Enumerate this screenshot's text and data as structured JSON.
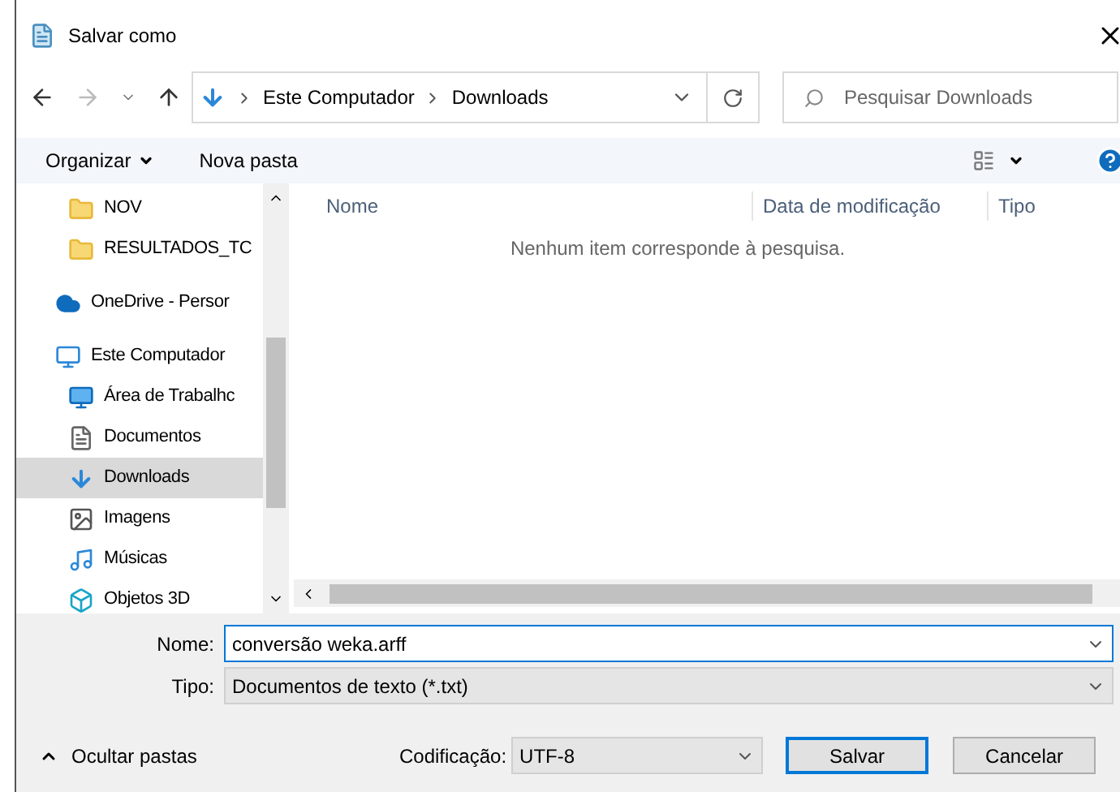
{
  "window": {
    "title": "Salvar como"
  },
  "address": {
    "path": [
      "Este Computador",
      "Downloads"
    ],
    "search_placeholder": "Pesquisar Downloads"
  },
  "toolbar": {
    "organize": "Organizar",
    "new_folder": "Nova pasta"
  },
  "sidebar": {
    "items": [
      {
        "label": "NOV",
        "kind": "folder",
        "selected": false
      },
      {
        "label": "RESULTADOS_TC",
        "kind": "folder",
        "selected": false
      },
      {
        "label": "OneDrive - Persor",
        "kind": "cloud",
        "selected": false
      },
      {
        "label": "Este Computador",
        "kind": "computer",
        "selected": false,
        "children": [
          {
            "label": "Área de Trabalhc",
            "kind": "desktop",
            "selected": false
          },
          {
            "label": "Documentos",
            "kind": "document",
            "selected": false
          },
          {
            "label": "Downloads",
            "kind": "download",
            "selected": true
          },
          {
            "label": "Imagens",
            "kind": "image",
            "selected": false
          },
          {
            "label": "Músicas",
            "kind": "music",
            "selected": false
          },
          {
            "label": "Objetos 3D",
            "kind": "cube",
            "selected": false
          }
        ]
      }
    ]
  },
  "table": {
    "columns": [
      "Nome",
      "Data de modificação",
      "Tipo"
    ],
    "empty_message": "Nenhum item corresponde à pesquisa."
  },
  "form": {
    "name_label": "Nome:",
    "name_value": "conversão weka.arff",
    "type_label": "Tipo:",
    "type_value": "Documentos de texto (*.txt)",
    "encoding_label": "Codificação:",
    "encoding_value": "UTF-8"
  },
  "hide_folders": "Ocultar pastas",
  "buttons": [
    "Salvar",
    "Cancelar"
  ]
}
